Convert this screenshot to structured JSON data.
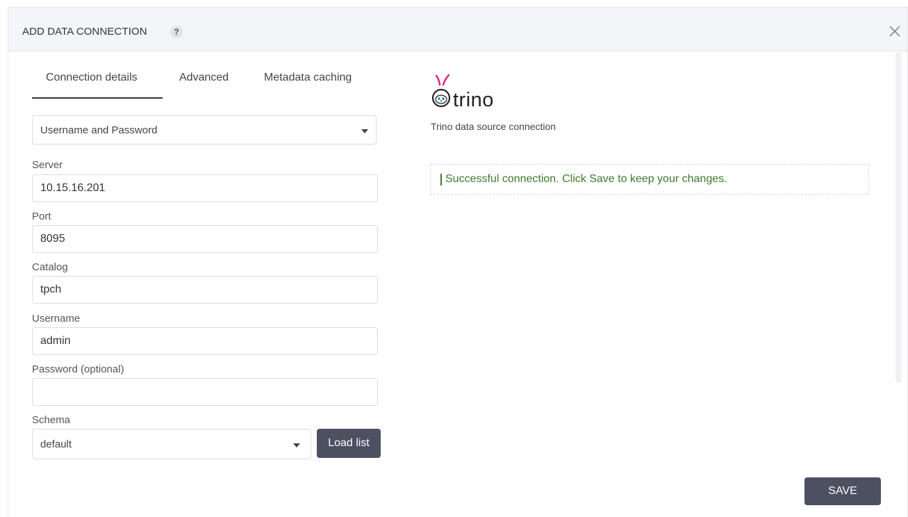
{
  "header": {
    "title": "ADD DATA CONNECTION",
    "help_icon_label": "?",
    "close_icon": "close-icon"
  },
  "tabs": [
    {
      "label": "Connection details",
      "active": true
    },
    {
      "label": "Advanced",
      "active": false
    },
    {
      "label": "Metadata caching",
      "active": false
    }
  ],
  "auth": {
    "selected": "Username and Password"
  },
  "fields": {
    "server": {
      "label": "Server",
      "value": "10.15.16.201"
    },
    "port": {
      "label": "Port",
      "value": "8095"
    },
    "catalog": {
      "label": "Catalog",
      "value": "tpch"
    },
    "username": {
      "label": "Username",
      "value": "admin"
    },
    "password": {
      "label": "Password (optional)",
      "value": ""
    },
    "schema": {
      "label": "Schema",
      "selected": "default"
    }
  },
  "buttons": {
    "load_list": "Load list",
    "save": "SAVE"
  },
  "source": {
    "name": "trino",
    "description": "Trino data source connection",
    "logo_icon": "trino-bunny-icon"
  },
  "status": {
    "message": "Successful connection. Click Save to keep your changes.",
    "color": "#3c7a2b"
  },
  "colors": {
    "button": "#4d5061",
    "header_bg": "#f4f5f8",
    "logo_accent": "#e0218a"
  }
}
